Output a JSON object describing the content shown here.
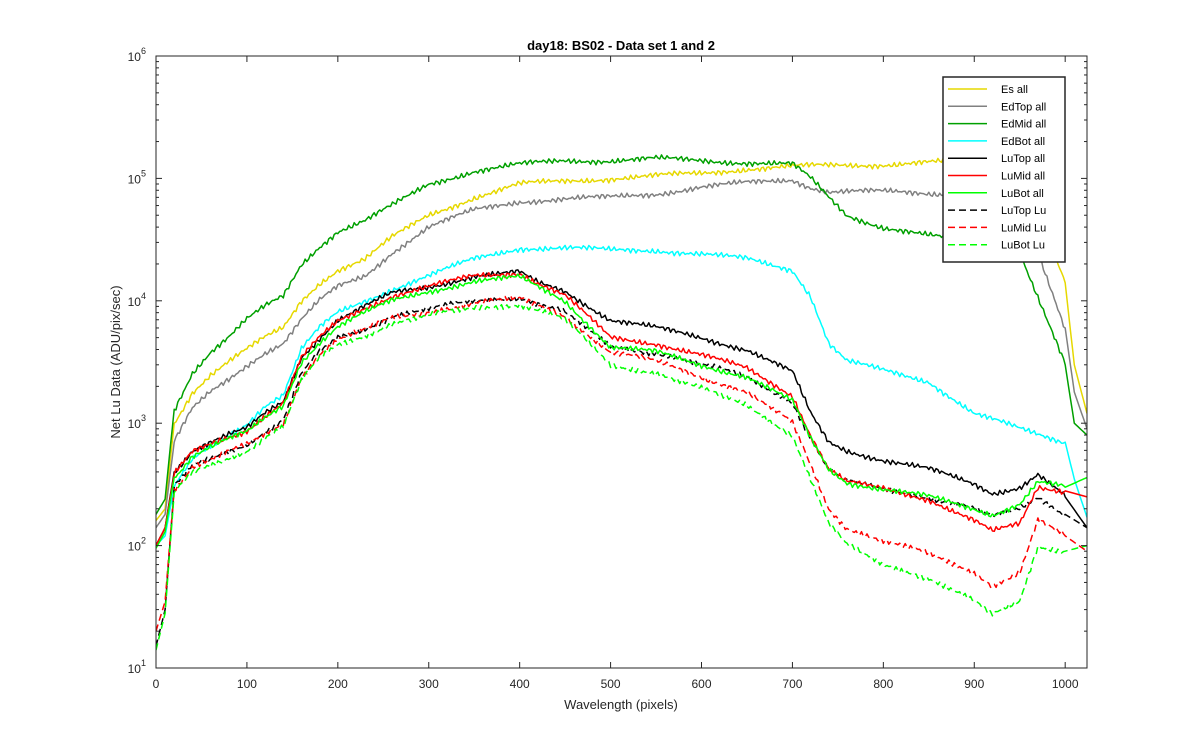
{
  "chart_data": {
    "type": "line",
    "title": "day18: BS02 - Data set 1 and 2",
    "xlabel": "Wavelength (pixels)",
    "ylabel": "Net Lu Data (ADU/pix/sec)",
    "xlim": [
      0,
      1024
    ],
    "ylim": [
      10,
      1000000
    ],
    "yscale": "log",
    "grid": false,
    "legend_position": "top-right",
    "x_ticks": [
      0,
      100,
      200,
      300,
      400,
      500,
      600,
      700,
      800,
      900,
      1000
    ],
    "y_ticks": [
      {
        "value": 10,
        "base": "10",
        "exp": "1"
      },
      {
        "value": 100,
        "base": "10",
        "exp": "2"
      },
      {
        "value": 1000,
        "base": "10",
        "exp": "3"
      },
      {
        "value": 10000,
        "base": "10",
        "exp": "4"
      },
      {
        "value": 100000,
        "base": "10",
        "exp": "5"
      },
      {
        "value": 1000000,
        "base": "10",
        "exp": "6"
      }
    ],
    "series": [
      {
        "name": "Es  all",
        "color": "#e6d800",
        "dash": false,
        "x": [
          0,
          10,
          20,
          40,
          60,
          80,
          100,
          120,
          140,
          160,
          180,
          200,
          230,
          260,
          300,
          350,
          400,
          450,
          500,
          550,
          600,
          650,
          700,
          750,
          800,
          850,
          900,
          950,
          1000,
          1010,
          1024
        ],
        "y": [
          160,
          200,
          1000,
          1800,
          2500,
          3200,
          4000,
          5000,
          6000,
          10000,
          14000,
          18000,
          22000,
          33000,
          50000,
          70000,
          90000,
          95000,
          100000,
          105000,
          110000,
          120000,
          125000,
          128000,
          130000,
          135000,
          140000,
          130000,
          14000,
          3000,
          1200
        ]
      },
      {
        "name": "EdTop  all",
        "color": "#808080",
        "dash": false,
        "x": [
          0,
          10,
          20,
          40,
          60,
          80,
          100,
          120,
          140,
          160,
          180,
          200,
          230,
          260,
          300,
          350,
          400,
          450,
          500,
          550,
          600,
          650,
          700,
          720,
          740,
          760,
          800,
          850,
          900,
          950,
          1000,
          1010,
          1024
        ],
        "y": [
          140,
          180,
          700,
          1300,
          1800,
          2300,
          3000,
          3800,
          4500,
          7000,
          10000,
          13000,
          16000,
          25000,
          40000,
          55000,
          65000,
          68000,
          70000,
          75000,
          85000,
          92000,
          98000,
          85000,
          78000,
          78000,
          78000,
          76000,
          74000,
          62000,
          6000,
          1800,
          900
        ]
      },
      {
        "name": "EdMid  all",
        "color": "#00a000",
        "dash": false,
        "x": [
          0,
          10,
          20,
          40,
          60,
          80,
          100,
          120,
          140,
          160,
          180,
          200,
          230,
          260,
          300,
          350,
          400,
          450,
          500,
          550,
          600,
          650,
          700,
          720,
          740,
          760,
          800,
          850,
          900,
          950,
          1000,
          1010,
          1024
        ],
        "y": [
          180,
          240,
          1300,
          2600,
          3800,
          5000,
          7000,
          9000,
          11000,
          20000,
          28000,
          37000,
          45000,
          60000,
          90000,
          115000,
          130000,
          140000,
          140000,
          145000,
          140000,
          135000,
          130000,
          100000,
          70000,
          50000,
          40000,
          34000,
          30000,
          25000,
          3000,
          1000,
          800
        ]
      },
      {
        "name": "EdBot  all",
        "color": "#00ffff",
        "dash": false,
        "x": [
          0,
          10,
          20,
          40,
          60,
          80,
          100,
          120,
          140,
          160,
          180,
          200,
          230,
          260,
          300,
          350,
          400,
          450,
          500,
          550,
          600,
          650,
          700,
          720,
          740,
          760,
          800,
          850,
          900,
          950,
          1000,
          1010,
          1024
        ],
        "y": [
          100,
          120,
          300,
          500,
          650,
          800,
          1000,
          1400,
          1700,
          4000,
          6000,
          8000,
          10000,
          12500,
          16000,
          22000,
          27000,
          27000,
          26000,
          26000,
          24000,
          22000,
          18000,
          11000,
          4500,
          3200,
          2700,
          2200,
          1200,
          900,
          700,
          350,
          170
        ]
      },
      {
        "name": "LuTop  all",
        "color": "#000000",
        "dash": false,
        "x": [
          0,
          10,
          20,
          40,
          60,
          80,
          100,
          120,
          140,
          160,
          180,
          200,
          230,
          260,
          300,
          350,
          400,
          420,
          450,
          500,
          550,
          600,
          650,
          700,
          720,
          740,
          760,
          800,
          850,
          900,
          920,
          950,
          970,
          1000,
          1024
        ],
        "y": [
          100,
          140,
          400,
          600,
          700,
          800,
          900,
          1200,
          1500,
          3500,
          5000,
          7000,
          9000,
          11500,
          13000,
          16000,
          17000,
          14000,
          12000,
          7000,
          6000,
          5000,
          4000,
          2600,
          1200,
          700,
          600,
          500,
          420,
          320,
          270,
          300,
          380,
          250,
          140
        ]
      },
      {
        "name": "LuMid  all",
        "color": "#ff0000",
        "dash": false,
        "x": [
          0,
          10,
          20,
          40,
          60,
          80,
          100,
          120,
          140,
          160,
          180,
          200,
          230,
          260,
          300,
          350,
          400,
          420,
          450,
          500,
          550,
          600,
          650,
          700,
          720,
          740,
          760,
          800,
          850,
          900,
          920,
          950,
          970,
          1000,
          1024
        ],
        "y": [
          100,
          140,
          380,
          580,
          680,
          780,
          880,
          1150,
          1450,
          3400,
          5000,
          6800,
          8800,
          11000,
          13000,
          16000,
          17000,
          14000,
          11000,
          5000,
          4500,
          3600,
          2800,
          1700,
          800,
          420,
          330,
          290,
          240,
          160,
          130,
          150,
          300,
          280,
          250
        ]
      },
      {
        "name": "LuBot  all",
        "color": "#00ff00",
        "dash": false,
        "x": [
          0,
          10,
          20,
          40,
          60,
          80,
          100,
          120,
          140,
          160,
          180,
          200,
          230,
          260,
          300,
          350,
          400,
          420,
          450,
          500,
          550,
          600,
          650,
          700,
          720,
          740,
          760,
          800,
          850,
          900,
          920,
          950,
          970,
          1000,
          1024
        ],
        "y": [
          95,
          130,
          360,
          540,
          640,
          740,
          840,
          1100,
          1400,
          3200,
          4600,
          6200,
          8000,
          10000,
          12000,
          14500,
          15500,
          13000,
          10000,
          4200,
          3800,
          3000,
          2400,
          1500,
          750,
          420,
          330,
          290,
          250,
          200,
          180,
          220,
          330,
          300,
          360
        ]
      },
      {
        "name": "LuTop  Lu",
        "color": "#000000",
        "dash": true,
        "x": [
          0,
          10,
          20,
          40,
          60,
          80,
          100,
          120,
          140,
          160,
          180,
          200,
          230,
          260,
          300,
          350,
          400,
          420,
          450,
          500,
          550,
          600,
          650,
          700,
          720,
          740,
          760,
          800,
          850,
          900,
          920,
          950,
          970,
          1000,
          1024
        ],
        "y": [
          15,
          30,
          300,
          450,
          520,
          600,
          680,
          850,
          1050,
          2500,
          3800,
          5000,
          6000,
          7500,
          8500,
          10000,
          10800,
          9500,
          8000,
          4200,
          3800,
          3000,
          2400,
          1500,
          750,
          420,
          330,
          290,
          250,
          200,
          170,
          200,
          250,
          180,
          140
        ]
      },
      {
        "name": "LuMid  Lu",
        "color": "#ff0000",
        "dash": true,
        "x": [
          0,
          10,
          20,
          40,
          60,
          80,
          100,
          120,
          140,
          160,
          180,
          200,
          230,
          260,
          300,
          350,
          400,
          420,
          450,
          500,
          550,
          600,
          650,
          700,
          720,
          740,
          760,
          800,
          850,
          900,
          920,
          950,
          970,
          1000,
          1024
        ],
        "y": [
          20,
          35,
          290,
          440,
          500,
          580,
          660,
          820,
          1000,
          2400,
          3700,
          4800,
          5800,
          7200,
          8200,
          9600,
          10400,
          9200,
          7600,
          3800,
          3200,
          2400,
          1800,
          1000,
          450,
          200,
          140,
          110,
          85,
          60,
          48,
          60,
          160,
          120,
          90
        ]
      },
      {
        "name": "LuBot  Lu",
        "color": "#00ff00",
        "dash": true,
        "x": [
          0,
          10,
          20,
          40,
          60,
          80,
          100,
          120,
          140,
          160,
          180,
          200,
          230,
          260,
          300,
          350,
          400,
          420,
          450,
          500,
          550,
          600,
          650,
          700,
          720,
          740,
          760,
          800,
          850,
          900,
          920,
          950,
          970,
          1000,
          1024
        ],
        "y": [
          14,
          28,
          270,
          400,
          460,
          530,
          600,
          760,
          920,
          2200,
          3400,
          4400,
          5300,
          6500,
          7500,
          8800,
          9400,
          8400,
          7000,
          3000,
          2600,
          1900,
          1400,
          800,
          350,
          150,
          100,
          70,
          55,
          35,
          27,
          35,
          100,
          90,
          100
        ]
      }
    ]
  }
}
